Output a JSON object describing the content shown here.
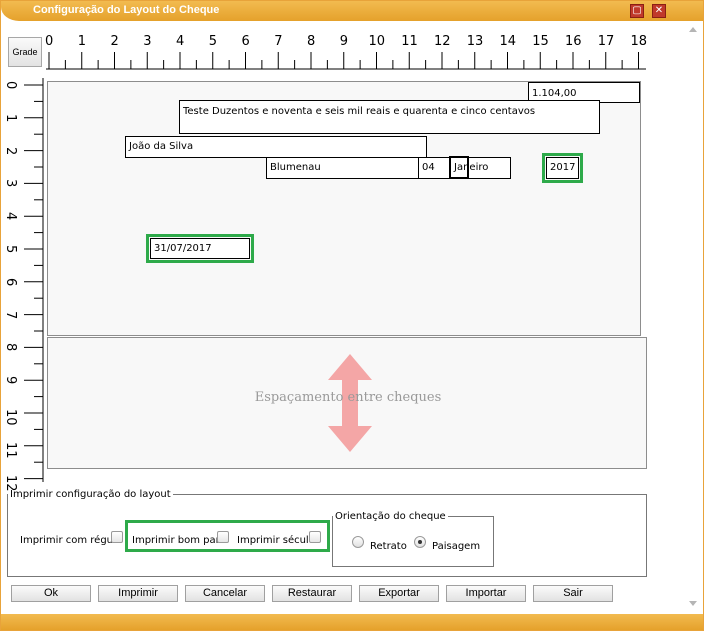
{
  "window": {
    "title": "Configuração do Layout do Cheque",
    "minimize_glyph": "▢",
    "close_glyph": "✕"
  },
  "grade_button": "Grade",
  "ruler_h": [
    "0",
    "1",
    "2",
    "3",
    "4",
    "5",
    "6",
    "7",
    "8",
    "9",
    "10",
    "11",
    "12",
    "13",
    "14",
    "15",
    "16",
    "17",
    "18"
  ],
  "ruler_v": [
    "0",
    "1",
    "2",
    "3",
    "4",
    "5",
    "6",
    "7",
    "8",
    "9",
    "10",
    "11",
    "12"
  ],
  "cheque_fields": {
    "valor": "1.104,00",
    "extenso": "Teste Duzentos e noventa e seis mil reais e quarenta e cinco centavos",
    "favorecido": "João da Silva",
    "cidade": "Blumenau",
    "dia": "04",
    "mes": "Janeiro",
    "ano": "2017",
    "bom_para": "31/07/2017"
  },
  "spacing_label": "Espaçamento entre cheques",
  "print_options": {
    "legend": "Imprimir configuração do layout",
    "com_regua": "Imprimir com régua",
    "bom_para": "Imprimir bom para",
    "seculo": "Imprimir século"
  },
  "orientation": {
    "legend": "Orientação do cheque",
    "retrato": "Retrato",
    "paisagem": "Paisagem",
    "selected": "Paisagem"
  },
  "buttons": {
    "ok": "Ok",
    "imprimir": "Imprimir",
    "cancelar": "Cancelar",
    "restaurar": "Restaurar",
    "exportar": "Exportar",
    "importar": "Importar",
    "sair": "Sair"
  },
  "colors": {
    "title_bar": "#e5a12b",
    "highlight": "#2eaa4a",
    "arrow": "#f4a6a6",
    "close_button": "#c0392b"
  },
  "icons": {
    "spacing_arrow": "double-arrow-vertical-icon",
    "scroll_up": "scroll-up-arrow-icon",
    "scroll_down": "scroll-down-arrow-icon"
  }
}
